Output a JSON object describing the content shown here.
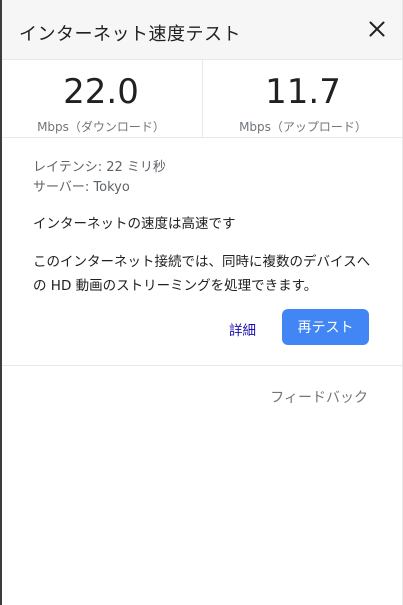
{
  "header": {
    "title": "インターネット速度テスト"
  },
  "metrics": {
    "download": {
      "value": "22.0",
      "unit": "Mbps（ダウンロード）"
    },
    "upload": {
      "value": "11.7",
      "unit": "Mbps（アップロード）"
    }
  },
  "details": {
    "latency": "レイテンシ: 22 ミリ秒",
    "server": "サーバー: Tokyo",
    "speed_summary": "インターネットの速度は高速です",
    "capability": "このインターネット接続では、同時に複数のデバイスへの HD 動画のストリーミングを処理できます。"
  },
  "actions": {
    "details_label": "詳細",
    "retest_label": "再テスト"
  },
  "footer": {
    "feedback_label": "フィードバック"
  },
  "icons": {
    "close": "close-icon"
  },
  "colors": {
    "accent": "#4285f4",
    "link": "#1a0dab",
    "header_bg": "#f6f6f6"
  }
}
